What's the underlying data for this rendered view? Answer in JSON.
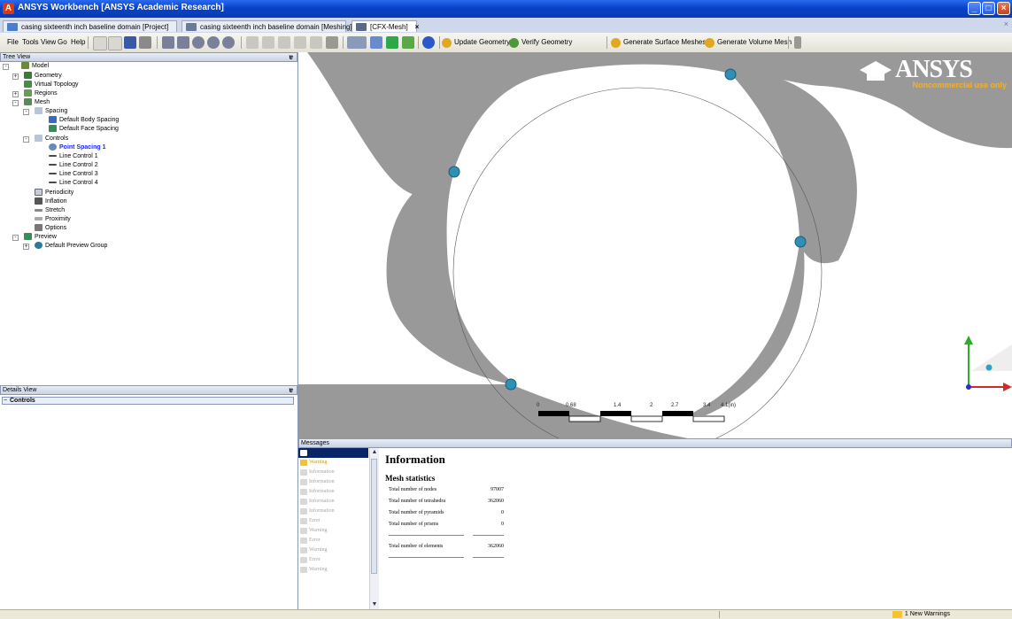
{
  "window": {
    "title": "ANSYS Workbench [ANSYS Academic Research]",
    "app_icon": "ansys-a-icon"
  },
  "tabs": [
    {
      "label": "casing sixteenth inch baseline domain [Project]",
      "icon": "project-icon",
      "active": false
    },
    {
      "label": "casing sixteenth inch baseline domain [Meshing]",
      "icon": "meshing-icon",
      "active": false
    },
    {
      "label": "[CFX-Mesh]",
      "icon": "cfx-mesh-icon",
      "active": true,
      "close": "×"
    }
  ],
  "menu": [
    "File",
    "Tools",
    "View",
    "Go",
    "Help"
  ],
  "toolbar_buttons": [
    "Update Geometry",
    "Verify Geometry",
    "Generate Surface Meshes",
    "Generate Volume Mesh"
  ],
  "tree": {
    "header": "Tree View",
    "pin": "ɐ",
    "nodes": [
      {
        "label": "Model",
        "level": 0
      },
      {
        "label": "Geometry",
        "level": 1
      },
      {
        "label": "Virtual Topology",
        "level": 1
      },
      {
        "label": "Regions",
        "level": 1
      },
      {
        "label": "Mesh",
        "level": 1
      },
      {
        "label": "Spacing",
        "level": 2
      },
      {
        "label": "Default Body Spacing",
        "level": 3
      },
      {
        "label": "Default Face Spacing",
        "level": 3
      },
      {
        "label": "Controls",
        "level": 2
      },
      {
        "label": "Point Spacing 1",
        "level": 3,
        "selected": true
      },
      {
        "label": "Line Control 1",
        "level": 3
      },
      {
        "label": "Line Control 2",
        "level": 3
      },
      {
        "label": "Line Control 3",
        "level": 3
      },
      {
        "label": "Line Control 4",
        "level": 3
      },
      {
        "label": "Periodicity",
        "level": 2
      },
      {
        "label": "Inflation",
        "level": 2
      },
      {
        "label": "Stretch",
        "level": 2
      },
      {
        "label": "Proximity",
        "level": 2
      },
      {
        "label": "Options",
        "level": 2
      },
      {
        "label": "Preview",
        "level": 1
      },
      {
        "label": "Default Preview Group",
        "level": 2
      }
    ]
  },
  "details": {
    "header": "Details View",
    "pin": "ɐ",
    "group": "Controls"
  },
  "viewport": {
    "logo_text": "ANSYS",
    "logo_subtitle": "Noncommercial use only",
    "scale_labels": [
      "0",
      "0.68",
      "1.4",
      "2",
      "2.7",
      "3.4",
      "4.1(in)"
    ],
    "colors": {
      "surface": "#999999",
      "points": "#2f8fb4",
      "background": "#ffffff"
    }
  },
  "messages": {
    "header": "Messages",
    "items": [
      {
        "label": "Warning",
        "type": "warning"
      },
      {
        "label": "Information",
        "type": "info"
      },
      {
        "label": "Information",
        "type": "info"
      },
      {
        "label": "Information",
        "type": "info"
      },
      {
        "label": "Information",
        "type": "info"
      },
      {
        "label": "Information",
        "type": "info"
      },
      {
        "label": "Error",
        "type": "error"
      },
      {
        "label": "Warning",
        "type": "warning-old"
      },
      {
        "label": "Error",
        "type": "error"
      },
      {
        "label": "Warning",
        "type": "warning-old"
      },
      {
        "label": "Error",
        "type": "error"
      },
      {
        "label": "Warning",
        "type": "warning-old"
      }
    ],
    "title": "Information",
    "section": "Mesh statistics",
    "stats": [
      {
        "label": "Total number of nodes",
        "value": "97007"
      },
      {
        "label": "Total number of tetrahedra",
        "value": "362060"
      },
      {
        "label": "Total number of pyramids",
        "value": "0"
      },
      {
        "label": "Total number of prisms",
        "value": "0"
      }
    ],
    "total": {
      "label": "Total number of elements",
      "value": "362060"
    }
  },
  "status": {
    "warnings": "1 New Warnings"
  }
}
